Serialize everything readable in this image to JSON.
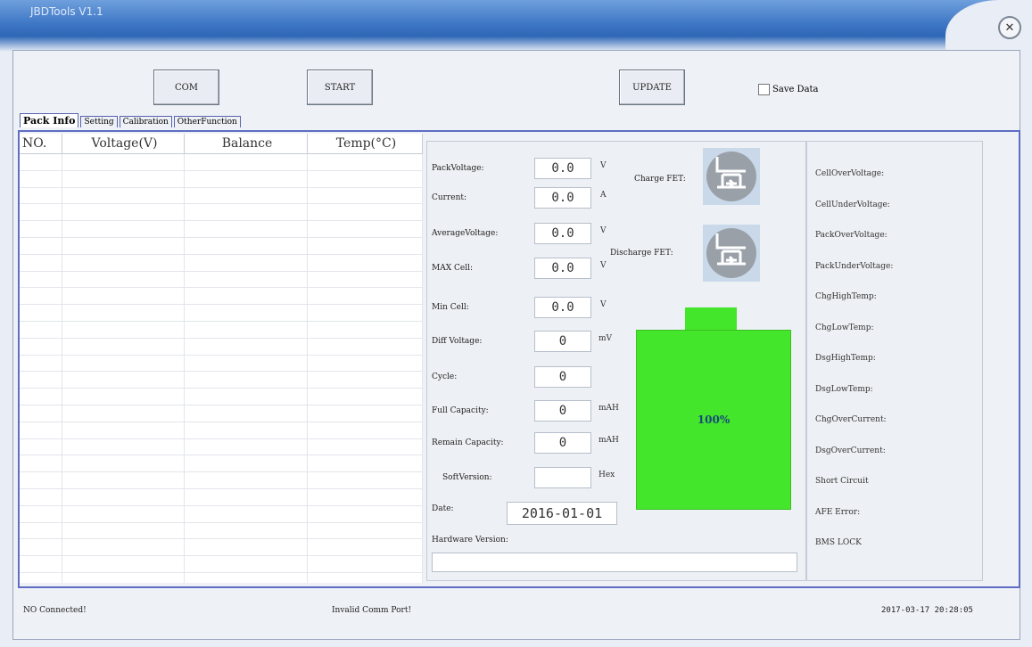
{
  "window": {
    "title": "JBDTools V1.1",
    "close_icon": "close-icon"
  },
  "toolbar": {
    "com_label": "COM",
    "start_label": "START",
    "update_label": "UPDATE",
    "save_data_label": "Save Data"
  },
  "tabs": [
    "Pack Info",
    "Setting",
    "Calibration",
    "OtherFunction"
  ],
  "table": {
    "headers": [
      "NO.",
      "Voltage(V)",
      "Balance",
      "Temp(°C)"
    ]
  },
  "pack": {
    "fields": [
      {
        "label": "PackVoltage:",
        "value": "0.0",
        "unit": "V"
      },
      {
        "label": "Current:",
        "value": "0.0",
        "unit": "A"
      },
      {
        "label": "AverageVoltage:",
        "value": "0.0",
        "unit": "V"
      },
      {
        "label": "MAX Cell:",
        "value": "0.0",
        "unit": "V"
      },
      {
        "label": "Min Cell:",
        "value": "0.0",
        "unit": "V"
      },
      {
        "label": "Diff Voltage:",
        "value": "0",
        "unit": "mV"
      },
      {
        "label": "Cycle:",
        "value": "0",
        "unit": ""
      },
      {
        "label": "Full Capacity:",
        "value": "0",
        "unit": "mAH"
      },
      {
        "label": "Remain Capacity:",
        "value": "0",
        "unit": "mAH"
      },
      {
        "label": "SoftVersion:",
        "value": "",
        "unit": "Hex"
      }
    ],
    "date_label": "Date:",
    "date_value": "2016-01-01",
    "hardware_label": "Hardware Version:",
    "charge_fet_label": "Charge FET:",
    "discharge_fet_label": "Discharge FET:",
    "battery_percent_text": "100%",
    "battery_level": 1.0,
    "battery_color": "#43e62b"
  },
  "protections": [
    "CellOverVoltage:",
    "CellUnderVoltage:",
    "PackOverVoltage:",
    "PackUnderVoltage:",
    "ChgHighTemp:",
    "ChgLowTemp:",
    "DsgHighTemp:",
    "DsgLowTemp:",
    "ChgOverCurrent:",
    "DsgOverCurrent:",
    "Short Circuit",
    "AFE Error:",
    "BMS LOCK"
  ],
  "status": {
    "connection": "NO Connected!",
    "message": "Invalid Comm Port!",
    "datetime": "2017-03-17 20:28:05"
  }
}
